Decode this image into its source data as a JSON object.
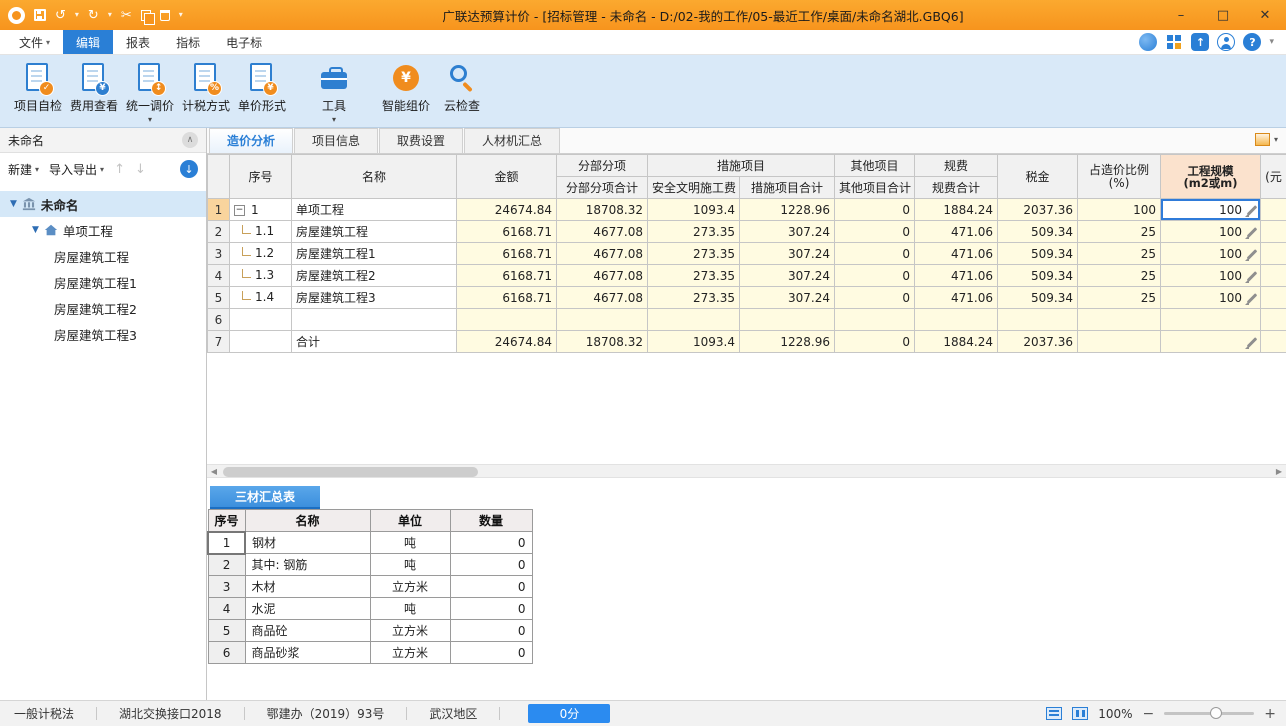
{
  "window": {
    "title": "广联达预算计价 - [招标管理 - 未命名 - D:/02-我的工作/05-最近工作/桌面/未命名湖北.GBQ6]"
  },
  "menu": {
    "items": [
      {
        "key": "file",
        "label": "文件",
        "dropdown": true,
        "active": false
      },
      {
        "key": "edit",
        "label": "编辑",
        "dropdown": false,
        "active": true
      },
      {
        "key": "report",
        "label": "报表",
        "dropdown": false,
        "active": false
      },
      {
        "key": "index",
        "label": "指标",
        "dropdown": false,
        "active": false
      },
      {
        "key": "e-bid",
        "label": "电子标",
        "dropdown": false,
        "active": false
      }
    ]
  },
  "toolbar": {
    "items": [
      {
        "key": "project-self-check",
        "label": "项目自检",
        "icon": "doc-check-icon",
        "badge": "✓",
        "badge_color": "orange",
        "dropdown": false,
        "group_gap": false
      },
      {
        "key": "cost-view",
        "label": "费用查看",
        "icon": "doc-cost-icon",
        "badge": "¥",
        "badge_color": "blue",
        "dropdown": false,
        "group_gap": false
      },
      {
        "key": "unified-price-adjust",
        "label": "统一调价",
        "icon": "doc-adjust-icon",
        "badge": "↕",
        "badge_color": "orange",
        "dropdown": true,
        "group_gap": false
      },
      {
        "key": "tax-mode",
        "label": "计税方式",
        "icon": "doc-tax-icon",
        "badge": "%",
        "badge_color": "orange",
        "dropdown": false,
        "group_gap": false
      },
      {
        "key": "unit-price-form",
        "label": "单价形式",
        "icon": "doc-price-icon",
        "badge": "¥",
        "badge_color": "orange",
        "dropdown": false,
        "group_gap": false
      },
      {
        "key": "tools",
        "label": "工具",
        "icon": "toolbox-icon",
        "badge": "",
        "badge_color": "",
        "dropdown": true,
        "group_gap": true
      },
      {
        "key": "smart-pricing",
        "label": "智能组价",
        "icon": "smart-price-icon",
        "badge": "",
        "badge_color": "",
        "dropdown": false,
        "group_gap": true
      },
      {
        "key": "cloud-check",
        "label": "云检查",
        "icon": "cloud-check-icon",
        "badge": "",
        "badge_color": "",
        "dropdown": false,
        "group_gap": false
      }
    ]
  },
  "sidebar": {
    "title": "未命名",
    "new_button": "新建",
    "import_export_button": "导入导出",
    "tree": [
      {
        "label": "未命名",
        "level": 0,
        "icon": "building-icon",
        "expandable": true,
        "selected": true
      },
      {
        "label": "单项工程",
        "level": 1,
        "icon": "house-icon",
        "expandable": true,
        "selected": false
      },
      {
        "label": "房屋建筑工程",
        "level": 2,
        "icon": "",
        "expandable": false,
        "selected": false
      },
      {
        "label": "房屋建筑工程1",
        "level": 2,
        "icon": "",
        "expandable": false,
        "selected": false
      },
      {
        "label": "房屋建筑工程2",
        "level": 2,
        "icon": "",
        "expandable": false,
        "selected": false
      },
      {
        "label": "房屋建筑工程3",
        "level": 2,
        "icon": "",
        "expandable": false,
        "selected": false
      }
    ]
  },
  "tabs": [
    {
      "key": "cost-analysis",
      "label": "造价分析",
      "active": true
    },
    {
      "key": "project-info",
      "label": "项目信息",
      "active": false
    },
    {
      "key": "fee-settings",
      "label": "取费设置",
      "active": false
    },
    {
      "key": "labor-material-summary",
      "label": "人材机汇总",
      "active": false
    }
  ],
  "main_table": {
    "headers": {
      "seq": "序号",
      "name": "名称",
      "amount": "金额",
      "fbfx_group": "分部分项",
      "fbfx_total": "分部分项合计",
      "csxm_group": "措施项目",
      "aqwm_fee": "安全文明施工费",
      "csxm_total": "措施项目合计",
      "qtxm_group": "其他项目",
      "qtxm_total": "其他项目合计",
      "gf_group": "规费",
      "gf_total": "规费合计",
      "tax": "税金",
      "ratio_line1": "占造价比例",
      "ratio_line2": "(%)",
      "scale_line1": "工程规模",
      "scale_line2": "(m2或m)",
      "partial": "(元"
    },
    "rows": [
      {
        "row": "1",
        "row_selected": true,
        "expander": "minus",
        "seq": "1",
        "name": "单项工程",
        "values": [
          "24674.84",
          "18708.32",
          "1093.4",
          "1228.96",
          "0",
          "1884.24",
          "2037.36",
          "100"
        ],
        "scale": "100",
        "scale_selected": true,
        "pencil": true
      },
      {
        "row": "2",
        "row_selected": false,
        "expander": "elbow",
        "seq": "1.1",
        "name": "房屋建筑工程",
        "values": [
          "6168.71",
          "4677.08",
          "273.35",
          "307.24",
          "0",
          "471.06",
          "509.34",
          "25"
        ],
        "scale": "100",
        "scale_selected": false,
        "pencil": true
      },
      {
        "row": "3",
        "row_selected": false,
        "expander": "elbow",
        "seq": "1.2",
        "name": "房屋建筑工程1",
        "values": [
          "6168.71",
          "4677.08",
          "273.35",
          "307.24",
          "0",
          "471.06",
          "509.34",
          "25"
        ],
        "scale": "100",
        "scale_selected": false,
        "pencil": true
      },
      {
        "row": "4",
        "row_selected": false,
        "expander": "elbow",
        "seq": "1.3",
        "name": "房屋建筑工程2",
        "values": [
          "6168.71",
          "4677.08",
          "273.35",
          "307.24",
          "0",
          "471.06",
          "509.34",
          "25"
        ],
        "scale": "100",
        "scale_selected": false,
        "pencil": true
      },
      {
        "row": "5",
        "row_selected": false,
        "expander": "elbow",
        "seq": "1.4",
        "name": "房屋建筑工程3",
        "values": [
          "6168.71",
          "4677.08",
          "273.35",
          "307.24",
          "0",
          "471.06",
          "509.34",
          "25"
        ],
        "scale": "100",
        "scale_selected": false,
        "pencil": true
      },
      {
        "row": "6",
        "row_selected": false,
        "expander": "",
        "seq": "",
        "name": "",
        "values": [
          "",
          "",
          "",
          "",
          "",
          "",
          "",
          ""
        ],
        "scale": "",
        "scale_selected": false,
        "pencil": false
      },
      {
        "row": "7",
        "row_selected": false,
        "expander": "",
        "seq": "",
        "name": "合计",
        "values": [
          "24674.84",
          "18708.32",
          "1093.4",
          "1228.96",
          "0",
          "1884.24",
          "2037.36",
          ""
        ],
        "scale": "",
        "scale_selected": false,
        "pencil": true
      }
    ]
  },
  "bottom_panel": {
    "tab": "三材汇总表",
    "headers": [
      "序号",
      "名称",
      "单位",
      "数量"
    ],
    "rows": [
      {
        "row": "1",
        "selected": true,
        "name": "钢材",
        "unit": "吨",
        "qty": "0"
      },
      {
        "row": "2",
        "selected": false,
        "name": "其中: 钢筋",
        "unit": "吨",
        "qty": "0"
      },
      {
        "row": "3",
        "selected": false,
        "name": "木材",
        "unit": "立方米",
        "qty": "0"
      },
      {
        "row": "4",
        "selected": false,
        "name": "水泥",
        "unit": "吨",
        "qty": "0"
      },
      {
        "row": "5",
        "selected": false,
        "name": "商品砼",
        "unit": "立方米",
        "qty": "0"
      },
      {
        "row": "6",
        "selected": false,
        "name": "商品砂浆",
        "unit": "立方米",
        "qty": "0"
      }
    ]
  },
  "statusbar": {
    "items": [
      "一般计税法",
      "湖北交换接口2018",
      "鄂建办（2019）93号",
      "武汉地区"
    ],
    "score": "0分",
    "zoom": "100%"
  }
}
